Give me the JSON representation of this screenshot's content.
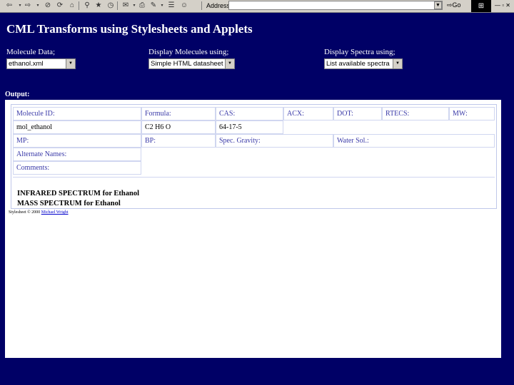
{
  "toolbar": {
    "address_label": "Address",
    "go_label": "Go"
  },
  "page": {
    "title": "CML Transforms using Stylesheets and Applets"
  },
  "controls": {
    "molecule": {
      "label": "Molecule Data;",
      "value": "ethanol.xml"
    },
    "display": {
      "label": "Display Molecules using;",
      "value": "Simple HTML datasheet"
    },
    "spectra": {
      "label": "Display Spectra using;",
      "value": "List available spectra"
    }
  },
  "output": {
    "label": "Output:",
    "fields": {
      "molecule_id": {
        "label": "Molecule ID:",
        "value": "mol_ethanol"
      },
      "formula": {
        "label": "Formula:",
        "value": "C2 H6 O"
      },
      "cas": {
        "label": "CAS:",
        "value": "64-17-5"
      },
      "acx": {
        "label": "ACX:"
      },
      "dot": {
        "label": "DOT:"
      },
      "rtecs": {
        "label": "RTECS:"
      },
      "mw": {
        "label": "MW:"
      },
      "mp": {
        "label": "MP:"
      },
      "bp": {
        "label": "BP:"
      },
      "spec_gravity": {
        "label": "Spec. Gravity:"
      },
      "water_sol": {
        "label": "Water Sol.:"
      },
      "alt_names": {
        "label": "Alternate Names:"
      },
      "comments": {
        "label": "Comments:"
      }
    },
    "spectra": [
      "INFRARED SPECTRUM for Ethanol",
      "MASS SPECTRUM for Ethanol"
    ],
    "footer": {
      "text": "Stylesheet © 2000",
      "author": "Michael Wright"
    }
  }
}
